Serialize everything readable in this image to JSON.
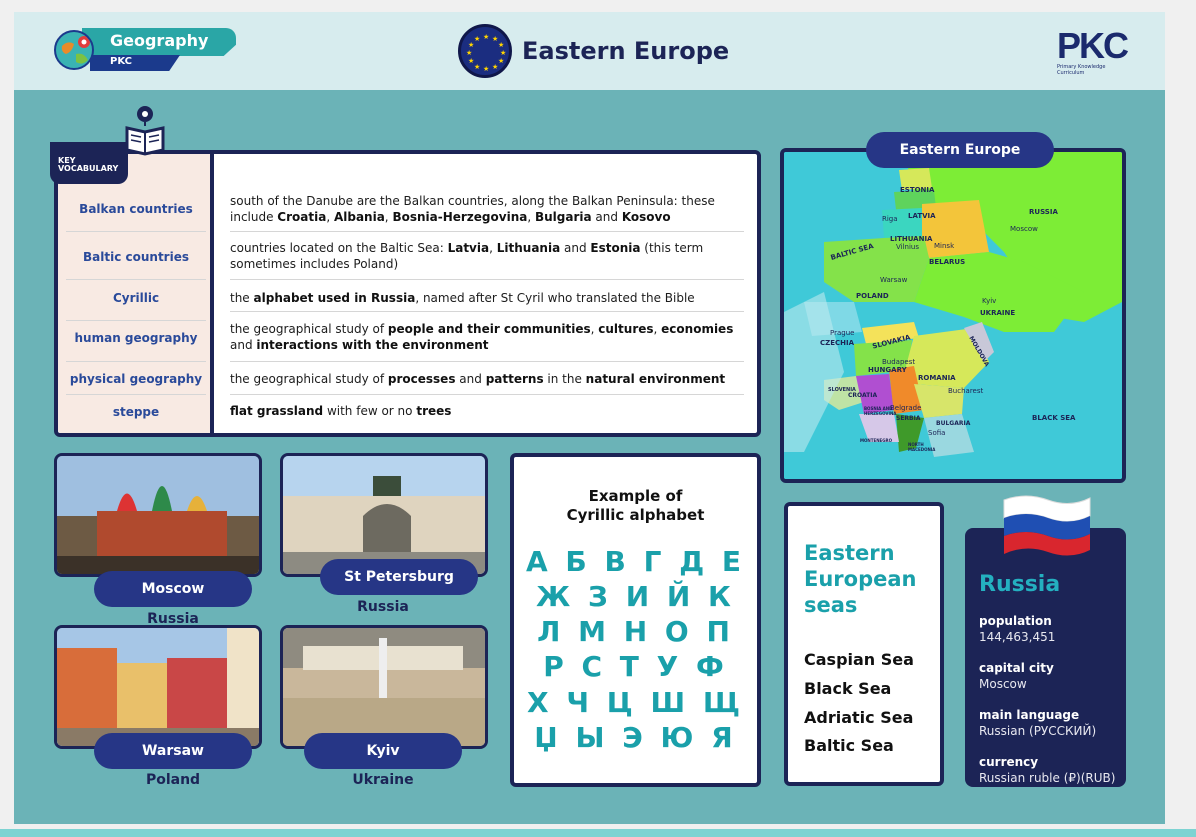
{
  "header": {
    "subject": "Geography",
    "subject_sub": "PKC",
    "title": "Eastern Europe",
    "logo_text": "PKC",
    "logo_sub1": "Primary Knowledge",
    "logo_sub2": "Curriculum"
  },
  "vocab": {
    "tag_line1": "KEY",
    "tag_line2": "VOCABULARY",
    "items": [
      {
        "term": "Balkan countries",
        "def": "south of the Danube are the Balkan countries, along the Balkan Peninsula: these include <b>Croatia</b>, <b>Albania</b>, <b>Bosnia-Herzegovina</b>, <b>Bulgaria</b> and <b>Kosovo</b>"
      },
      {
        "term": "Baltic countries",
        "def": "countries located on the Baltic Sea: <b>Latvia</b>, <b>Lithuania</b> and <b>Estonia</b> (this term sometimes includes Poland)"
      },
      {
        "term": "Cyrillic",
        "def": "the <b>alphabet used in Russia</b>, named after St Cyril who translated the Bible"
      },
      {
        "term": "human geography",
        "def": "the geographical study of <b>people and their communities</b>, <b>cultures</b>, <b>economies</b> and <b>interactions with the environment</b>"
      },
      {
        "term": "physical geography",
        "def": "the geographical study of <b>processes</b> and <b>patterns</b> in the <b>natural environment</b>"
      },
      {
        "term": "steppe",
        "def": "<b>flat grassland</b> with few or no <b>trees</b>"
      }
    ]
  },
  "map": {
    "title": "Eastern Europe",
    "labels": {
      "estonia": "ESTONIA",
      "latvia": "LATVIA",
      "russia": "RUSSIA",
      "moscow": "Moscow",
      "riga": "Riga",
      "lithuania": "LITHUANIA",
      "vilnius": "Vilnius",
      "minsk": "Minsk",
      "belarus": "BELARUS",
      "baltic": "BALTIC SEA",
      "warsaw": "Warsaw",
      "poland": "POLAND",
      "kyiv": "Kyiv",
      "ukraine": "UKRAINE",
      "prague": "Prague",
      "czechia": "CZECHIA",
      "slovakia": "SLOVAKIA",
      "moldova": "MOLDOVA",
      "budapest": "Budapest",
      "hungary": "HUNGARY",
      "romania": "ROMANIA",
      "bucharest": "Bucharest",
      "slovenia": "SLOVENIA",
      "croatia": "CROATIA",
      "belgrade": "Belgrade",
      "serbia": "SERBIA",
      "bosnia": "BOSNIA AND HERZEGOVINA",
      "bulgaria": "BULGARIA",
      "sofia": "Sofia",
      "montenegro": "MONTENEGRO",
      "north_macedonia": "NORTH MACEDONIA",
      "black_sea": "BLACK SEA"
    }
  },
  "photos": [
    {
      "city": "Moscow",
      "country": "Russia"
    },
    {
      "city": "St Petersburg",
      "country": "Russia"
    },
    {
      "city": "Warsaw",
      "country": "Poland"
    },
    {
      "city": "Kyiv",
      "country": "Ukraine"
    }
  ],
  "alphabet": {
    "title_line1": "Example of",
    "title_line2": "Cyrillic alphabet",
    "rows": [
      "А Б В Г Д Е",
      "Ж З И Й К",
      "Л М Н О П",
      "Р С Т У Ф",
      "Х Ч Ц Ш Щ",
      "Џ Ы Э Ю Я"
    ]
  },
  "seas": {
    "title_line1": "Eastern",
    "title_line2": "European",
    "title_line3": "seas",
    "items": [
      "Caspian Sea",
      "Black Sea",
      "Adriatic Sea",
      "Baltic Sea"
    ]
  },
  "russia": {
    "title": "Russia",
    "facts": [
      {
        "key": "population",
        "value": "144,463,451"
      },
      {
        "key": "capital city",
        "value": "Moscow"
      },
      {
        "key": "main language",
        "value": "Russian (РУССКИЙ)"
      },
      {
        "key": "currency",
        "value": "Russian ruble (₽)(RUB)"
      }
    ]
  },
  "colors": {
    "navy": "#1c2456",
    "teal": "#1aa0aa",
    "background": "#6bb3b7",
    "header": "#d7ecee"
  }
}
